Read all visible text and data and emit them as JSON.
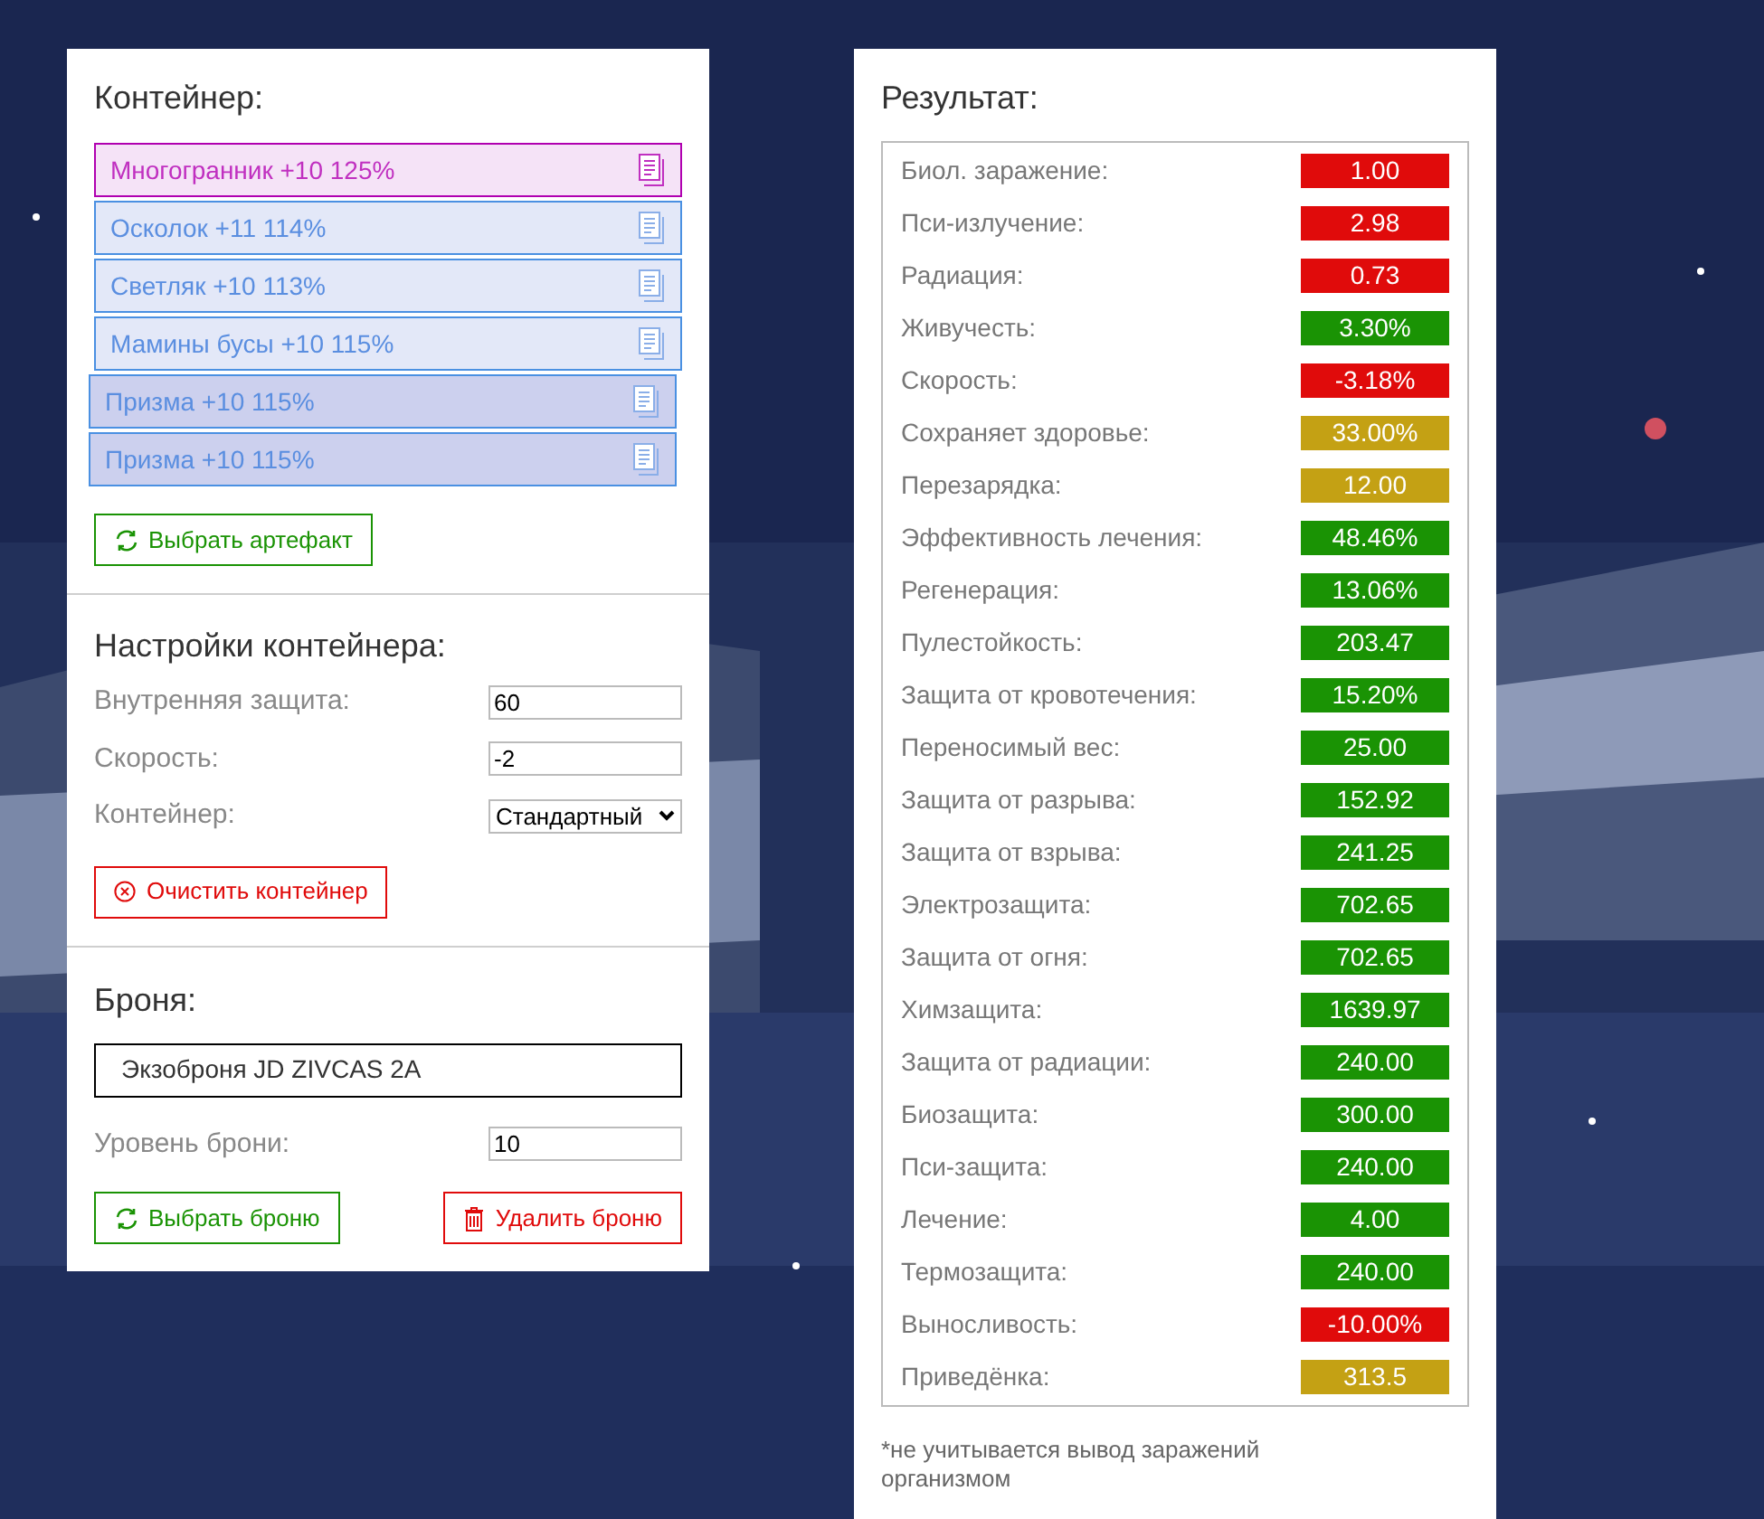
{
  "container": {
    "title": "Контейнер:",
    "artifacts": [
      {
        "label": "Многогранник +10 125%",
        "selected": true,
        "kind": "normal"
      },
      {
        "label": "Осколок +11 114%",
        "selected": false,
        "kind": "normal"
      },
      {
        "label": "Светляк +10 113%",
        "selected": false,
        "kind": "normal"
      },
      {
        "label": "Мамины бусы +10 115%",
        "selected": false,
        "kind": "normal"
      },
      {
        "label": "Призма +10 115%",
        "selected": false,
        "kind": "offset"
      },
      {
        "label": "Призма +10 115%",
        "selected": false,
        "kind": "offset"
      }
    ],
    "choose_button": "Выбрать артефакт"
  },
  "settings": {
    "title": "Настройки контейнера:",
    "fields": [
      {
        "label": "Внутренняя защита:",
        "value": "60",
        "kind": "input"
      },
      {
        "label": "Скорость:",
        "value": "-2",
        "kind": "input"
      },
      {
        "label": "Контейнер:",
        "value": "Стандартный",
        "kind": "select"
      }
    ],
    "clear_button": "Очистить контейнер"
  },
  "armor": {
    "title": "Броня:",
    "name": "Экзоброня JD ZIVCAS 2A",
    "level_label": "Уровень брони:",
    "level_value": "10",
    "choose_button": "Выбрать броню",
    "delete_button": "Удалить броню"
  },
  "result": {
    "title": "Результат:",
    "rows": [
      {
        "label": "Биол. заражение:",
        "value": "1.00",
        "color": "#e00b0b"
      },
      {
        "label": "Пси-излучение:",
        "value": "2.98",
        "color": "#e00b0b"
      },
      {
        "label": "Радиация:",
        "value": "0.73",
        "color": "#e00b0b"
      },
      {
        "label": "Живучесть:",
        "value": "3.30%",
        "color": "#1a9304"
      },
      {
        "label": "Скорость:",
        "value": "-3.18%",
        "color": "#e00b0b"
      },
      {
        "label": "Сохраняет здоровье:",
        "value": "33.00%",
        "color": "#c4a114"
      },
      {
        "label": "Перезарядка:",
        "value": "12.00",
        "color": "#c4a114"
      },
      {
        "label": "Эффективность лечения:",
        "value": "48.46%",
        "color": "#1a9304"
      },
      {
        "label": "Регенерация:",
        "value": "13.06%",
        "color": "#1a9304"
      },
      {
        "label": "Пулестойкость:",
        "value": "203.47",
        "color": "#1a9304"
      },
      {
        "label": "Защита от кровотечения:",
        "value": "15.20%",
        "color": "#1a9304"
      },
      {
        "label": "Переносимый вес:",
        "value": "25.00",
        "color": "#1a9304"
      },
      {
        "label": "Защита от разрыва:",
        "value": "152.92",
        "color": "#1a9304"
      },
      {
        "label": "Защита от взрыва:",
        "value": "241.25",
        "color": "#1a9304"
      },
      {
        "label": "Электрозащита:",
        "value": "702.65",
        "color": "#1a9304"
      },
      {
        "label": "Защита от огня:",
        "value": "702.65",
        "color": "#1a9304"
      },
      {
        "label": "Химзащита:",
        "value": "1639.97",
        "color": "#1a9304"
      },
      {
        "label": "Защита от радиации:",
        "value": "240.00",
        "color": "#1a9304"
      },
      {
        "label": "Биозащита:",
        "value": "300.00",
        "color": "#1a9304"
      },
      {
        "label": "Пси-защита:",
        "value": "240.00",
        "color": "#1a9304"
      },
      {
        "label": "Лечение:",
        "value": "4.00",
        "color": "#1a9304"
      },
      {
        "label": "Термозащита:",
        "value": "240.00",
        "color": "#1a9304"
      },
      {
        "label": "Выносливость:",
        "value": "-10.00%",
        "color": "#e00b0b"
      },
      {
        "label": "Приведёнка:",
        "value": "313.5",
        "color": "#c4a114"
      }
    ],
    "footnote": "*не учитывается вывод заражений организмом"
  }
}
